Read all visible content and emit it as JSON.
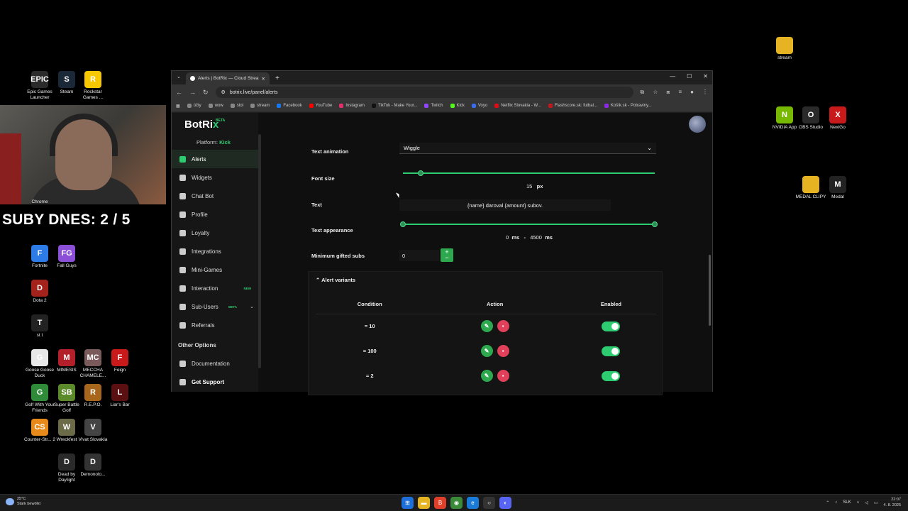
{
  "desktop": {
    "left_icons": [
      {
        "label": "Epic Games Launcher",
        "color": "#2b2b2b",
        "glyph": "EPIC"
      },
      {
        "label": "Steam",
        "color": "#1b2838",
        "glyph": "S"
      },
      {
        "label": "Rockstar Games ...",
        "color": "#f7c700",
        "glyph": "R"
      },
      {
        "label": "Chrome",
        "color": "#333333",
        "glyph": ""
      },
      {
        "label": "Fortnite",
        "color": "#2d7be6",
        "glyph": "F"
      },
      {
        "label": "Fall Guys",
        "color": "#8c4fd8",
        "glyph": "FG"
      },
      {
        "label": "Dota 2",
        "color": "#a3221c",
        "glyph": "D"
      },
      {
        "label": "st t",
        "color": "#222222",
        "glyph": "T"
      },
      {
        "label": "Goose Goose Duck",
        "color": "#e8e8e8",
        "glyph": "G"
      },
      {
        "label": "MIMESIS",
        "color": "#b3202a",
        "glyph": "M"
      },
      {
        "label": "MECCHA CHAMELE...",
        "color": "#7a5a5a",
        "glyph": "MC"
      },
      {
        "label": "Feign",
        "color": "#c81a1a",
        "glyph": "F"
      },
      {
        "label": "Golf With Your Friends",
        "color": "#2f8a3a",
        "glyph": "G"
      },
      {
        "label": "Super Battle Golf",
        "color": "#5a8a2a",
        "glyph": "SB"
      },
      {
        "label": "R.E.P.O.",
        "color": "#a8651c",
        "glyph": "R"
      },
      {
        "label": "Liar's Bar",
        "color": "#5a1010",
        "glyph": "L"
      },
      {
        "label": "Counter-Str... 2",
        "color": "#e88a1a",
        "glyph": "CS"
      },
      {
        "label": "Wreckfest",
        "color": "#6b6b4a",
        "glyph": "W"
      },
      {
        "label": "Vivat Slovakia",
        "color": "#444444",
        "glyph": "V"
      },
      {
        "label": "Dead by Daylight",
        "color": "#2a2a2a",
        "glyph": "D"
      },
      {
        "label": "Demonolo...",
        "color": "#333333",
        "glyph": "D"
      }
    ],
    "right_icons": [
      {
        "label": "stream",
        "color": "#e6b422",
        "glyph": ""
      },
      {
        "label": "NVIDIA App",
        "color": "#76b900",
        "glyph": "N"
      },
      {
        "label": "OBS Studio",
        "color": "#2a2a2a",
        "glyph": "O"
      },
      {
        "label": "NexiGo",
        "color": "#c81a1a",
        "glyph": "X"
      },
      {
        "label": "MEDAL CLIPY",
        "color": "#e6b422",
        "glyph": ""
      },
      {
        "label": "Medal",
        "color": "#222222",
        "glyph": "M"
      }
    ],
    "sub_counter": "SUBY DNES: 2 / 5"
  },
  "browser": {
    "tab_title": "Alerts | BotRix — Cloud Stream...",
    "url": "botrix.live/panel/alerts",
    "bookmarks": [
      "účty",
      "wow",
      "stol",
      "stream",
      "Facebook",
      "YouTube",
      "Instagram",
      "TikTok - Make Your...",
      "Twitch",
      "Kick",
      "Voyo",
      "Netflix Slovakia - W...",
      "Flashscore.sk: futbal...",
      "Košík.sk - Potraviny..."
    ]
  },
  "app": {
    "logo_text": "BotRi",
    "logo_x": "x",
    "logo_beta": "BETA",
    "platform_label": "Platform:",
    "platform_value": "Kick",
    "nav": [
      {
        "label": "Alerts",
        "active": true
      },
      {
        "label": "Widgets"
      },
      {
        "label": "Chat Bot"
      },
      {
        "label": "Profile"
      },
      {
        "label": "Loyalty"
      },
      {
        "label": "Integrations"
      },
      {
        "label": "Mini-Games"
      },
      {
        "label": "Interaction",
        "badge": "NEW"
      },
      {
        "label": "Sub-Users",
        "badge": "BETA",
        "chevron": "⌄"
      },
      {
        "label": "Referrals"
      }
    ],
    "other_options_heading": "Other Options",
    "nav_other": [
      {
        "label": "Documentation"
      },
      {
        "label": "Get Support"
      }
    ]
  },
  "form": {
    "text_animation_label": "Text animation",
    "text_animation_value": "Wiggle",
    "font_size_label": "Font size",
    "font_size_value": "15",
    "font_size_unit": "px",
    "font_size_slider_fraction": 0.07,
    "text_label": "Text",
    "text_value": "{name} daroval {amount} subov.",
    "text_appearance_label": "Text appearance",
    "appearance_from": "0",
    "appearance_to": "4500",
    "appearance_unit": "ms",
    "appearance_sep": "-",
    "min_gifted_label": "Minimum gifted subs",
    "min_gifted_value": "0"
  },
  "variants": {
    "heading": "Alert variants",
    "columns": [
      "Condition",
      "Action",
      "Enabled"
    ],
    "rows": [
      {
        "condition": "= 10",
        "enabled": true
      },
      {
        "condition": "= 100",
        "enabled": true
      },
      {
        "condition": "= 2",
        "enabled": true
      }
    ]
  },
  "taskbar": {
    "temperature": "25°C",
    "weather": "Stark bewölkt",
    "lang": "SLK",
    "time": "22:07",
    "date": "4. 8. 2025"
  }
}
